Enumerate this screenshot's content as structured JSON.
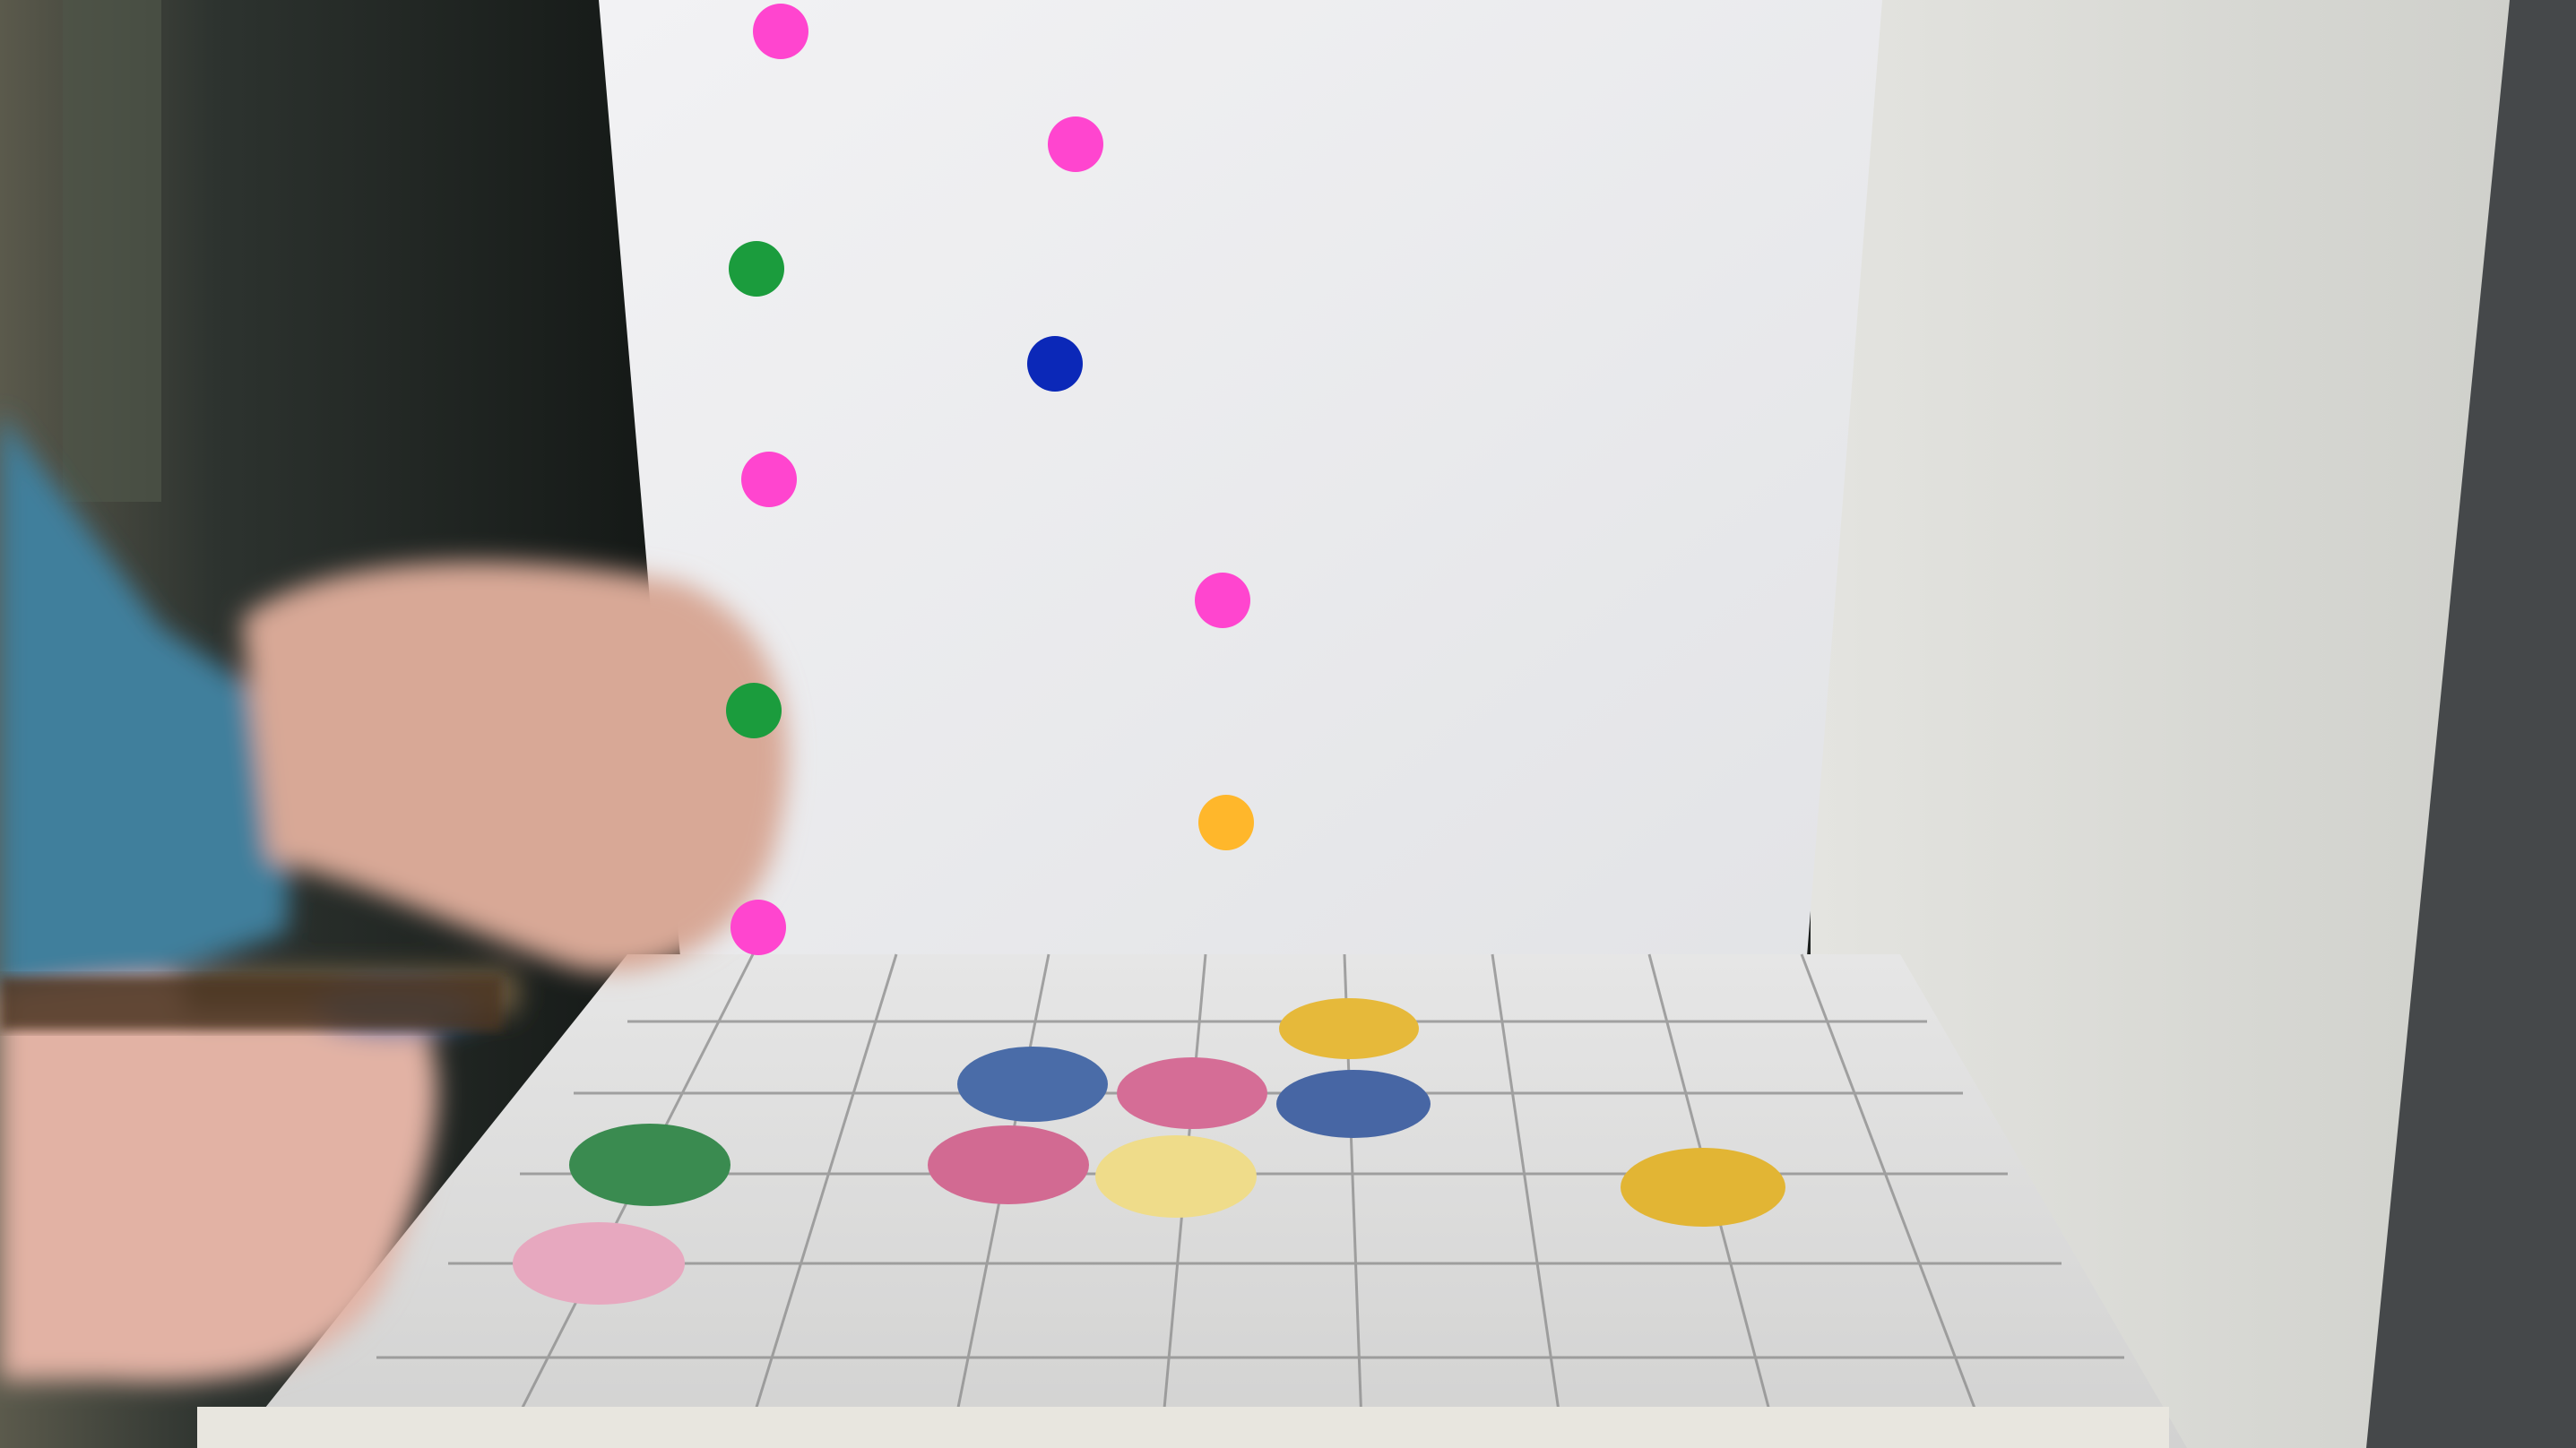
{
  "colors": {
    "pink": "#ff45cf",
    "green": "#1b9c3d",
    "blue": "#0b28b8",
    "orange": "#ffb72b",
    "wall": "#e9eaec",
    "board": "#dcdcdb",
    "shelf_right": "#d8d9d5",
    "skin": "#d7a38f",
    "sleeve": "#3d7c97",
    "felt_blue": "#4a6faa",
    "felt_pink": "#d26a91",
    "felt_lightpink": "#e9adc2",
    "felt_yellow": "#e3c64a",
    "felt_lightyellow": "#efde8e",
    "felt_green": "#3b8c4f",
    "grid_line": "#7f7f7f"
  },
  "overlay_markers": [
    {
      "name": "marker-pink-1",
      "color": "pink"
    },
    {
      "name": "marker-pink-2",
      "color": "pink"
    },
    {
      "name": "marker-green-1",
      "color": "green"
    },
    {
      "name": "marker-blue-1",
      "color": "blue"
    },
    {
      "name": "marker-pink-3",
      "color": "pink"
    },
    {
      "name": "marker-pink-4",
      "color": "pink"
    },
    {
      "name": "marker-green-2",
      "color": "green"
    },
    {
      "name": "marker-orange-1",
      "color": "orange"
    },
    {
      "name": "marker-pink-5",
      "color": "pink"
    }
  ]
}
